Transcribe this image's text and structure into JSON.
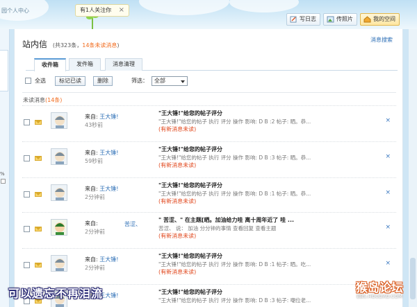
{
  "banner": {
    "breadcrumb": "园个人中心",
    "follow_tip": "有1人关注你",
    "follow_close": "×",
    "buttons": {
      "diary": "写日志",
      "photo": "传照片",
      "home": "我的空间"
    }
  },
  "sidebar": {
    "pct": "%"
  },
  "page": {
    "title": "站内信",
    "count_prefix": "(共323条，",
    "unread_count": "14条未读消息",
    "count_suffix": ")",
    "search_link": "消息搜索"
  },
  "tabs": [
    {
      "label": "收件箱"
    },
    {
      "label": "发件箱"
    },
    {
      "label": "消息清理"
    }
  ],
  "toolbar": {
    "select_all": "全选",
    "mark_read": "标记已读",
    "delete": "删除",
    "filter_label": "筛选：",
    "filter_value": "全部"
  },
  "unread_section": {
    "label": "未读消息",
    "count": "(14条)"
  },
  "messages": [
    {
      "from_label": "来自:",
      "from_name": "王大锤!",
      "time": "43秒前",
      "subject": "\"王大锤!\"给您的帖子评分",
      "preview": "\"王大锤!\"给您的帖子 执行 评分 操作 影响: D B :2 帖子: 晒。恭...",
      "status": "(有新消息未读)",
      "delete": "×"
    },
    {
      "from_label": "来自:",
      "from_name": "王大锤!",
      "time": "59秒前",
      "subject": "\"王大锤!\"给您的帖子评分",
      "preview": "\"王大锤!\"给您的帖子 执行 评分 操作 影响: D B :3 帖子: 晒。恭...",
      "status": "(有新消息未读)",
      "delete": "×"
    },
    {
      "from_label": "来自:",
      "from_name": "王大锤!",
      "time": "2分钟前",
      "subject": "\"王大锤!\"给您的帖子评分",
      "preview": "\"王大锤!\"给您的帖子 执行 评分 操作 影响: D B :1 帖子: 晒。恭...",
      "status": "(有新消息未读)",
      "delete": "×"
    },
    {
      "from_label": "来自:",
      "from_name": "",
      "time": "2分钟前",
      "subject": "\"         苦涩、\" 在主题[晒。加油给力哇 离十周年近了 哇 ...",
      "preview": "苦涩、 说： 加油 分分钟的事情 查看回复 查看主题",
      "status": "(有新消息未读)",
      "delete": "×",
      "from_extra": "苦涩、"
    },
    {
      "from_label": "来自:",
      "from_name": "王大锤!",
      "time": "2分钟前",
      "subject": "\"王大锤!\"给您的帖子评分",
      "preview": "\"王大锤!\"给您的帖子 执行 评分 操作 影响: D B :1 帖子: 晒。吃...",
      "status": "(有新消息未读)",
      "delete": "×"
    },
    {
      "from_label": "来自:",
      "from_name": "王大锤!",
      "time": "",
      "subject": "\"王大锤!\"给您的帖子评分",
      "preview": "\"王大锤!\"给您的帖子 执行 评分 操作 影响: D B :3 帖子: 嘲位老...",
      "status": "",
      "delete": ""
    }
  ],
  "overlay": {
    "caption": "可以遗忘不再泪流",
    "watermark_big": "猴岛论坛",
    "watermark_small": "BBS.HOUDAO.COM"
  },
  "colors": {
    "accent": "#2a6db5",
    "unread": "#f26b1d",
    "new_msg": "#e0461b"
  }
}
